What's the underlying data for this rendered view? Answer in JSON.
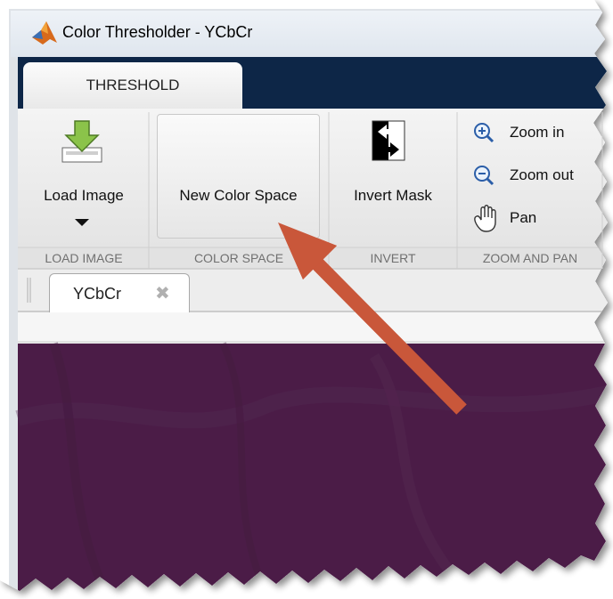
{
  "window": {
    "title": "Color Thresholder - YCbCr"
  },
  "tabs": [
    {
      "label": "THRESHOLD",
      "active": true
    }
  ],
  "ribbon": {
    "load_image": {
      "label": "Load Image",
      "section": "LOAD IMAGE"
    },
    "color_space": {
      "label": "New Color Space",
      "section": "COLOR SPACE"
    },
    "invert": {
      "label": "Invert Mask",
      "section": "INVERT"
    },
    "zoom_pan": {
      "zoom_in": "Zoom in",
      "zoom_out": "Zoom out",
      "pan": "Pan",
      "section": "ZOOM AND PAN"
    }
  },
  "document_tabs": [
    {
      "label": "YCbCr"
    }
  ],
  "colors": {
    "ribbon_header": "#0d2847",
    "ribbon_bg": "#ececec",
    "image_area": "#4b1e47",
    "arrow": "#c9573a"
  },
  "icons": [
    "app-logo-icon",
    "load-image-icon",
    "new-color-space-icon",
    "invert-mask-icon",
    "zoom-in-icon",
    "zoom-out-icon",
    "pan-hand-icon",
    "close-icon",
    "pointer-arrow"
  ]
}
